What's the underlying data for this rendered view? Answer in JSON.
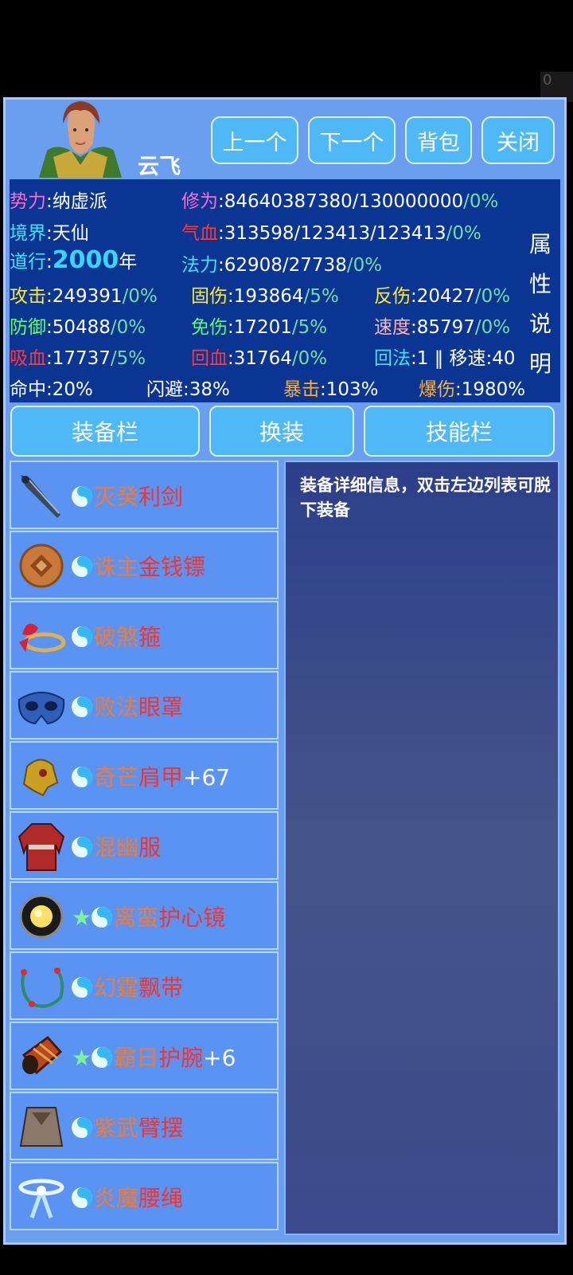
{
  "character": {
    "name": "云飞"
  },
  "nav": {
    "prev": "上一个",
    "next": "下一个",
    "bag": "背包",
    "close": "关闭"
  },
  "stats": {
    "faction_label": "势力",
    "faction_value": ":纳虚派",
    "cultivation_label": "修为",
    "cultivation_value": ":84640387380/130000000",
    "cultivation_pct": "/0%",
    "realm_label": "境界",
    "realm_value": ":天仙",
    "hp_label": "气血",
    "hp_value": ":313598/123413/123413",
    "hp_pct": "/0%",
    "dao_label": "道行",
    "dao_colon": ":",
    "dao_value": "2000",
    "dao_unit": "年",
    "mp_label": "法力",
    "mp_value": ":62908/27738",
    "mp_pct": "/0%",
    "attack_label": "攻击",
    "attack_value": ":249391",
    "attack_pct": "/0%",
    "fixed_dmg_label": "固伤",
    "fixed_dmg_value": ":193864",
    "fixed_dmg_pct": "/5%",
    "reflect_label": "反伤",
    "reflect_value": ":20427",
    "reflect_pct": "/0%",
    "defense_label": "防御",
    "defense_value": ":50488",
    "defense_pct": "/0%",
    "immune_label": "免伤",
    "immune_value": ":17201",
    "immune_pct": "/5%",
    "speed_label": "速度",
    "speed_value": ":85797",
    "speed_pct": "/0%",
    "lifesteal_label": "吸血",
    "lifesteal_value": ":17737",
    "lifesteal_pct": "/5%",
    "regen_label": "回血",
    "regen_value": ":31764",
    "regen_pct": "/0%",
    "mp_regen_label": "回法",
    "mp_regen_value": ":1 ‖ ",
    "move_label": "移速",
    "move_value": ":40",
    "hit_label": "命中",
    "hit_value": ":20%",
    "dodge_label": "闪避",
    "dodge_value": ":38%",
    "crit_label": "暴击",
    "crit_value": ":103%",
    "critdmg_label": "爆伤",
    "critdmg_value": ":1980%",
    "attr_desc": "属性说明"
  },
  "tabs": {
    "equip": "装备栏",
    "swap": "换装",
    "skills": "技能栏"
  },
  "equipment": [
    {
      "icon": "sword-icon",
      "star": "",
      "p1": "灭癸",
      "p2": "利剑",
      "suffix": ""
    },
    {
      "icon": "coin-dart-icon",
      "star": "",
      "p1": "诛主",
      "p2": "金钱镖",
      "suffix": ""
    },
    {
      "icon": "headband-icon",
      "star": "",
      "p1": "破煞",
      "p2": "箍",
      "suffix": ""
    },
    {
      "icon": "mask-icon",
      "star": "",
      "p1": "败法",
      "p2": "眼罩",
      "suffix": ""
    },
    {
      "icon": "pauldron-icon",
      "star": "",
      "p1": "奇芒",
      "p2": "肩甲",
      "suffix": "+67"
    },
    {
      "icon": "robe-icon",
      "star": "",
      "p1": "混幽",
      "p2": "服",
      "suffix": ""
    },
    {
      "icon": "mirror-icon",
      "star": "★",
      "p1": "离蛮",
      "p2": "护心镜",
      "suffix": ""
    },
    {
      "icon": "sash-icon",
      "star": "",
      "p1": "幻霆",
      "p2": "飘带",
      "suffix": ""
    },
    {
      "icon": "bracer-icon",
      "star": "★",
      "p1": "霸日",
      "p2": "护腕",
      "suffix": "+6"
    },
    {
      "icon": "arm-guard-icon",
      "star": "",
      "p1": "紫武",
      "p2": "臂摆",
      "suffix": ""
    },
    {
      "icon": "waist-rope-icon",
      "star": "",
      "p1": "炎魔",
      "p2": "腰绳",
      "suffix": ""
    }
  ],
  "detail": {
    "text": "装备详细信息，双击左边列表可脱下装备"
  }
}
